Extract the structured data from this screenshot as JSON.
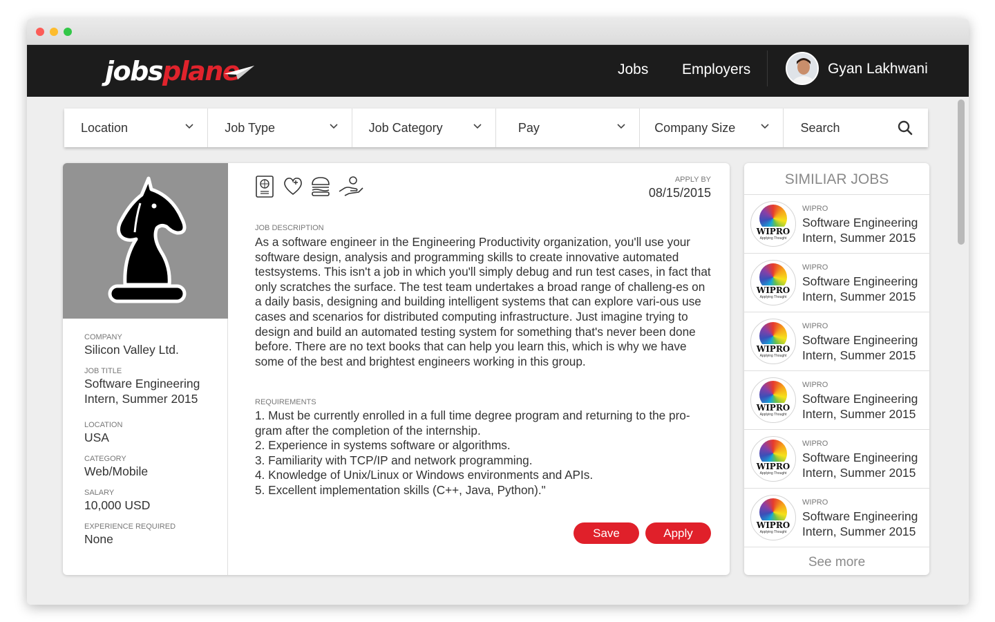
{
  "nav": {
    "logo_text_1": "jobs",
    "logo_text_2": "plane",
    "links": [
      "Jobs",
      "Employers"
    ],
    "user_name": "Gyan Lakhwani"
  },
  "filters": [
    {
      "label": "Location",
      "icon": "chevron-down-icon"
    },
    {
      "label": "Job Type",
      "icon": "chevron-down-icon"
    },
    {
      "label": "Job Category",
      "icon": "chevron-down-icon"
    },
    {
      "label": "Pay",
      "icon": "chevron-down-icon"
    },
    {
      "label": "Company Size",
      "icon": "chevron-down-icon"
    },
    {
      "label": "Search",
      "icon": "search-icon"
    }
  ],
  "job": {
    "company_label": "COMPANY",
    "company": "Silicon Valley Ltd.",
    "title_label": "JOB TITLE",
    "title": "Software Engineering Intern, Summer 2015",
    "location_label": "LOCATION",
    "location": "USA",
    "category_label": "CATEGORY",
    "category": "Web/Mobile",
    "salary_label": "SALARY",
    "salary": "10,000 USD",
    "experience_label": "EXPERIENCE REQUIRED",
    "experience": "None",
    "apply_by_label": "APPLY BY",
    "apply_by": "08/15/2015",
    "perk_icons": [
      "passport-icon",
      "health-icon",
      "food-icon",
      "benefits-hand-icon"
    ],
    "description_label": "JOB DESCRIPTION",
    "description": "As a software engineer in the Engineering Productivity organization, you'll use your software design, analysis and programming skills to create innovative automated testsystems. This isn't a job in which you'll simply debug and run test cases, in fact that only scratches the surface. The test team undertakes a broad range of challeng-es on a daily basis, designing and building intelligent systems that can explore vari-ous use cases and scenarios for distributed computing infrastructure. Just imagine trying to design and build an automated testing system for something that's never been done before. There are no text books that can help you learn this, which is why we have some of the best and brightest engineers working in this group.",
    "requirements_label": "REQUIREMENTS",
    "requirements": [
      "1. Must be currently enrolled in a full time degree program and returning to the pro-gram after the completion of the internship.",
      "2. Experience in systems software or algorithms.",
      "3. Familiarity with TCP/IP and network programming.",
      "4. Knowledge of Unix/Linux or Windows environments and APIs.",
      "5. Excellent implementation skills (C++, Java, Python).\""
    ],
    "save_label": "Save",
    "apply_label": "Apply"
  },
  "similar": {
    "title": "SIMILIAR JOBS",
    "logo_word": "WIPRO",
    "logo_tagline": "Applying Thought",
    "items": [
      {
        "company": "WIPRO",
        "title": "Software Engineering Intern, Summer 2015"
      },
      {
        "company": "WIPRO",
        "title": "Software Engineering Intern, Summer 2015"
      },
      {
        "company": "WIPRO",
        "title": "Software Engineering Intern, Summer 2015"
      },
      {
        "company": "WIPRO",
        "title": "Software Engineering Intern, Summer 2015"
      },
      {
        "company": "WIPRO",
        "title": "Software Engineering Intern, Summer 2015"
      },
      {
        "company": "WIPRO",
        "title": "Software Engineering Intern, Summer 2015"
      }
    ],
    "see_more": "See more"
  },
  "colors": {
    "accent": "#e0202a",
    "navbar": "#1c1c1c",
    "background": "#eeeeee",
    "logo_box": "#939393"
  }
}
